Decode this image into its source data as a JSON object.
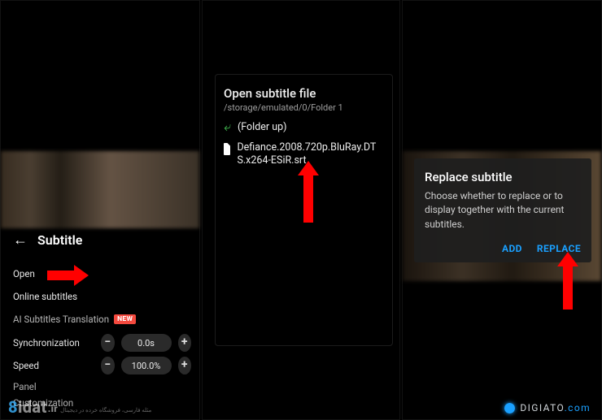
{
  "left": {
    "header": "Subtitle",
    "options": {
      "open": "Open",
      "online": "Online subtitles",
      "ai": "AI Subtitles Translation",
      "ai_badge": "NEW",
      "sync_label": "Synchronization",
      "sync_value": "0.0s",
      "speed_label": "Speed",
      "speed_value": "100.0%",
      "panel": "Panel",
      "customization": "Customization"
    }
  },
  "mid": {
    "title": "Open subtitle file",
    "path": "/storage/emulated/0/Folder 1",
    "folder_up": "(Folder up)",
    "file": "Defiance.2008.720p.BluRay.DTS.x264-ESiR.srt"
  },
  "right": {
    "title": "Replace subtitle",
    "body": "Choose whether to replace or to display together with the current subtitles.",
    "add": "ADD",
    "replace": "REPLACE"
  },
  "watermark": {
    "left_brand_pre": "8",
    "left_brand_rest": "idat",
    "left_brand_suffix": ".ir",
    "left_tagline": "مثله فارسی، فروشگاه خرده در دیجیتال",
    "right_brand": "DIGIATO",
    "right_dot": ".",
    "right_com": "com"
  }
}
